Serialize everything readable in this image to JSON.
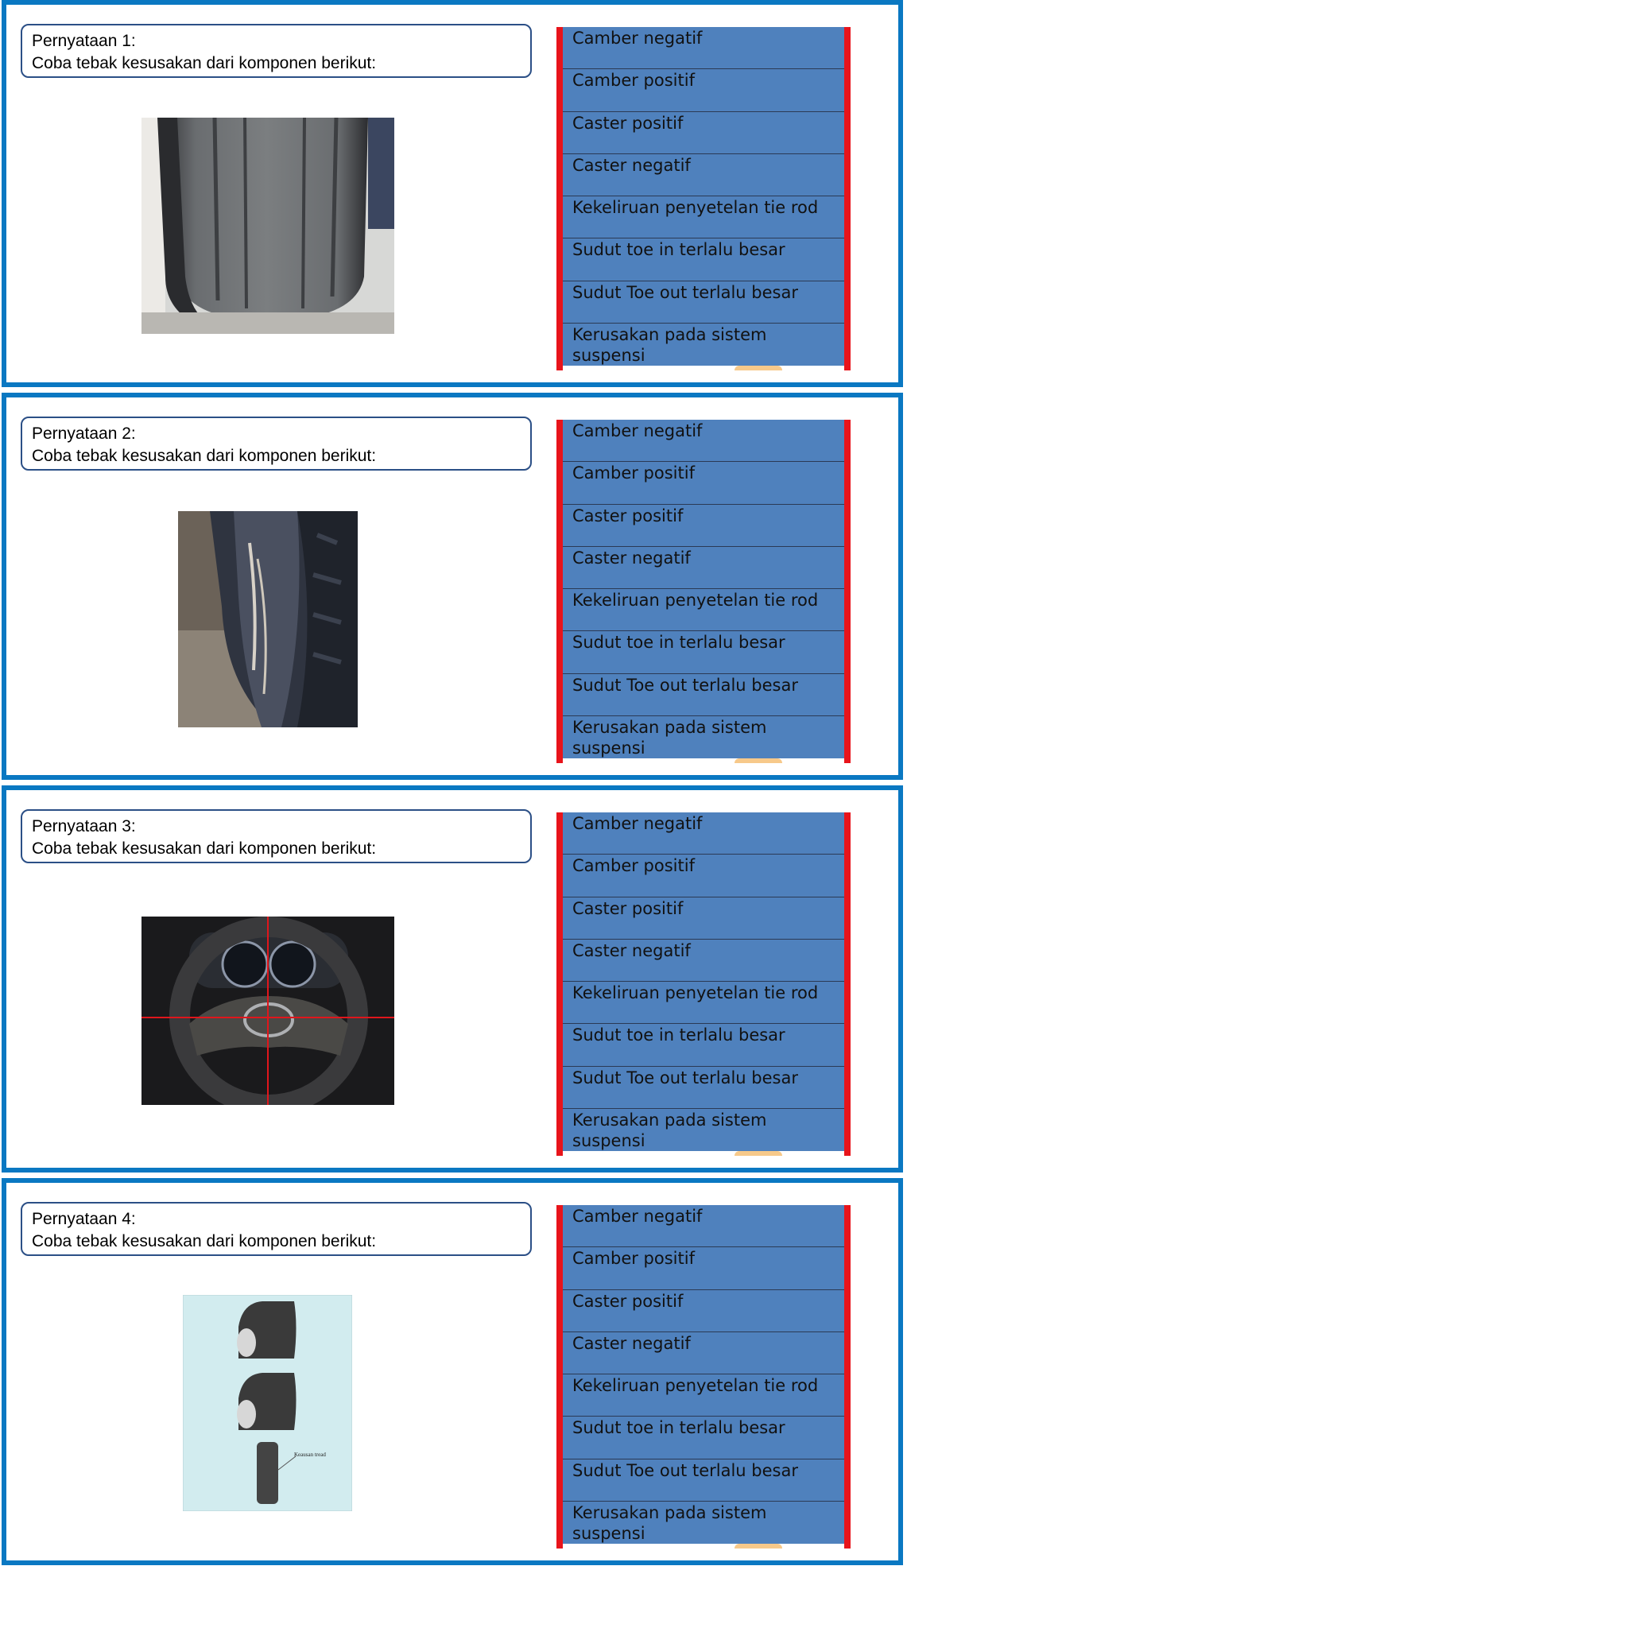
{
  "slides": [
    {
      "title": "Pernyataan 1:",
      "question": "Coba tebak kesusakan dari komponen berikut:",
      "image": "worn-tire-photo",
      "options": [
        "Camber negatif",
        "Camber positif",
        "Caster positif",
        "Caster negatif",
        "Kekeliruan penyetelan tie rod",
        "Sudut toe in terlalu besar",
        "Sudut Toe out terlalu besar",
        "Kerusakan pada sistem suspensi"
      ]
    },
    {
      "title": "Pernyataan 2:",
      "question": "Coba tebak kesusakan dari komponen berikut:",
      "image": "tire-sidewall-wear-photo",
      "options": [
        "Camber negatif",
        "Camber positif",
        "Caster positif",
        "Caster negatif",
        "Kekeliruan penyetelan tie rod",
        "Sudut toe in terlalu besar",
        "Sudut Toe out terlalu besar",
        "Kerusakan pada sistem suspensi"
      ]
    },
    {
      "title": "Pernyataan 3:",
      "question": "Coba tebak kesusakan dari komponen berikut:",
      "image": "steering-wheel-photo",
      "options": [
        "Camber negatif",
        "Camber positif",
        "Caster positif",
        "Caster negatif",
        "Kekeliruan penyetelan tie rod",
        "Sudut toe in terlalu besar",
        "Sudut Toe out terlalu besar",
        "Kerusakan pada sistem suspensi"
      ]
    },
    {
      "title": "Pernyataan 4:",
      "question": "Coba tebak kesusakan dari komponen berikut:",
      "image": "tire-wear-diagram",
      "diagram_label": "Keausan tread",
      "options": [
        "Camber negatif",
        "Camber positif",
        "Caster positif",
        "Caster negatif",
        "Kekeliruan penyetelan tie rod",
        "Sudut toe in terlalu besar",
        "Sudut Toe out terlalu besar",
        "Kerusakan pada sistem suspensi"
      ]
    }
  ],
  "colors": {
    "panel_border": "#0a78c2",
    "option_fill": "#4f81bd",
    "bar_red": "#e8141b",
    "prompt_border": "#2b4f86"
  }
}
